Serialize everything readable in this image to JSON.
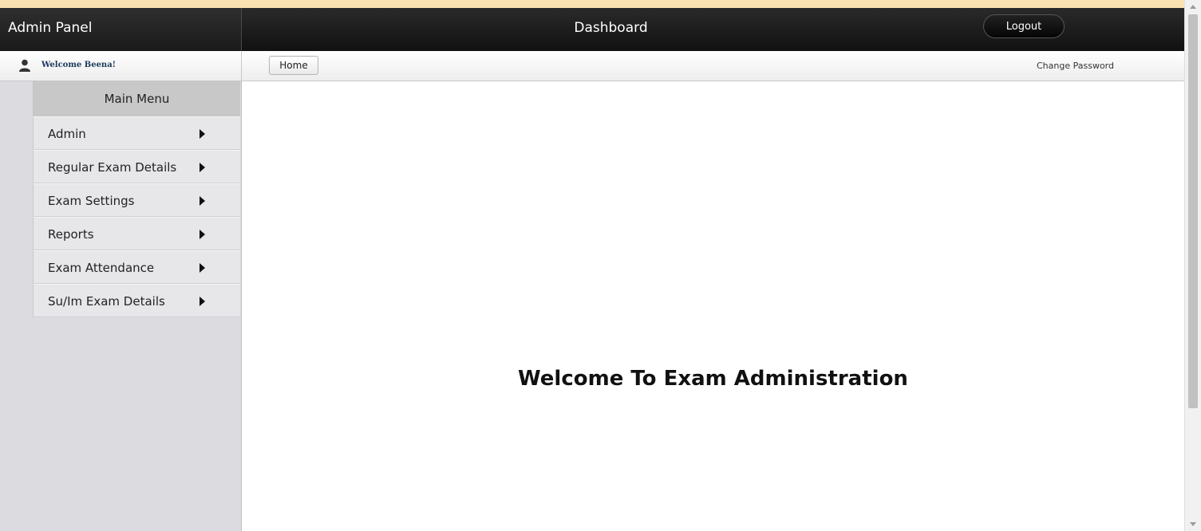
{
  "header": {
    "brand": "Admin Panel",
    "title": "Dashboard",
    "logout_label": "Logout"
  },
  "subbar": {
    "welcome": "Welcome Beena!",
    "home_label": "Home",
    "change_password": "Change Password"
  },
  "sidebar": {
    "menu_title": "Main Menu",
    "items": [
      {
        "label": "Admin"
      },
      {
        "label": "Regular Exam Details"
      },
      {
        "label": "Exam Settings"
      },
      {
        "label": "Reports"
      },
      {
        "label": "Exam Attendance"
      },
      {
        "label": "Su/Im Exam Details"
      }
    ]
  },
  "main": {
    "welcome_title": "Welcome To Exam Administration"
  },
  "icons": {
    "user": "user-icon",
    "submenu": "caret-right-icon"
  }
}
